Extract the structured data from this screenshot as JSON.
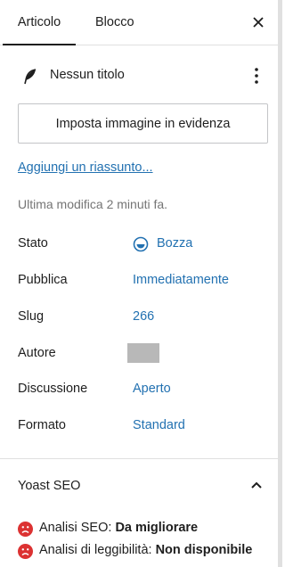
{
  "tabs": {
    "post": "Articolo",
    "block": "Blocco"
  },
  "post": {
    "title": "Nessun titolo"
  },
  "featured_image": {
    "button_label": "Imposta immagine in evidenza"
  },
  "excerpt": {
    "link_label": "Aggiungi un riassunto..."
  },
  "last_modified": "Ultima modifica 2 minuti fa.",
  "meta": {
    "status": {
      "label": "Stato",
      "value": "Bozza"
    },
    "publish": {
      "label": "Pubblica",
      "value": "Immediatamente"
    },
    "slug": {
      "label": "Slug",
      "value": "266"
    },
    "author": {
      "label": "Autore"
    },
    "discussion": {
      "label": "Discussione",
      "value": "Aperto"
    },
    "format": {
      "label": "Formato",
      "value": "Standard"
    }
  },
  "yoast": {
    "title": "Yoast SEO",
    "seo_label": "Analisi SEO:",
    "seo_value": "Da migliorare",
    "readability_label": "Analisi di leggibilità:",
    "readability_value": "Non disponibile"
  },
  "colors": {
    "link": "#2271b1",
    "bad": "#dc3232",
    "text": "#1e1e1e",
    "muted": "#757575"
  },
  "icons": {
    "close": "close-icon",
    "feather": "feather-icon",
    "more": "more-vertical-icon",
    "status": "draft-status-icon",
    "collapse": "chevron-up-icon",
    "score": "sad-face-icon"
  }
}
